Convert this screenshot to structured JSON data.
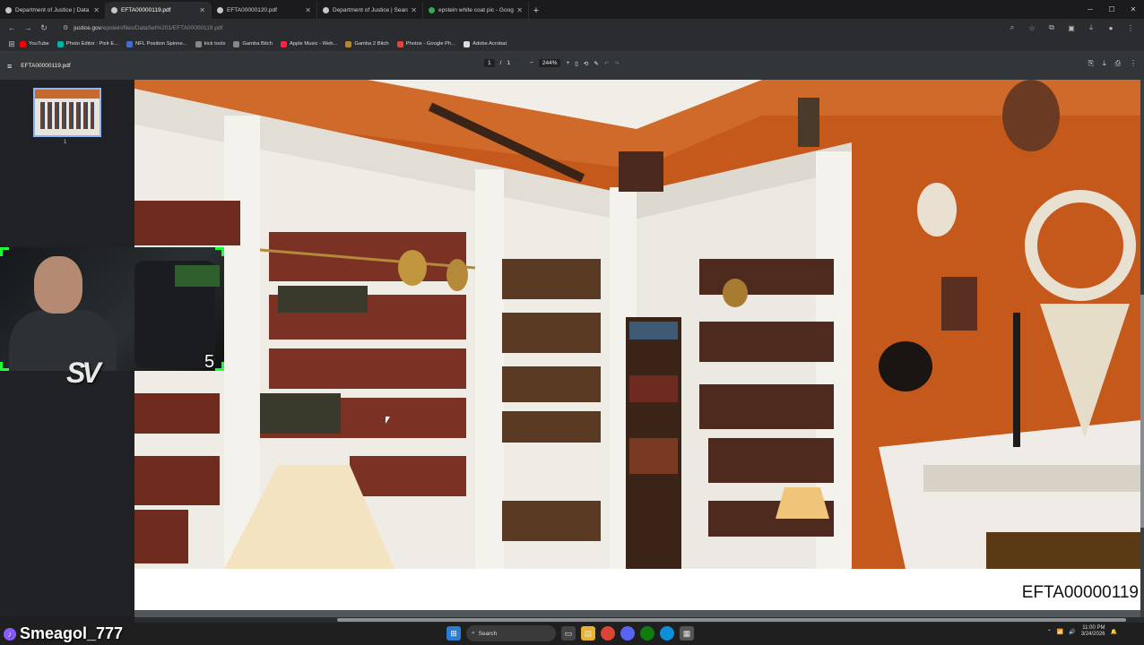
{
  "tabs": [
    {
      "title": "Department of Justice | Data Se",
      "color": "#c7c7c7",
      "active": false
    },
    {
      "title": "EFTA00000119.pdf",
      "color": "#c7c7c7",
      "active": true
    },
    {
      "title": "EFTA00000120.pdf",
      "color": "#c7c7c7",
      "active": false
    },
    {
      "title": "Department of Justice | Search",
      "color": "#c7c7c7",
      "active": false
    },
    {
      "title": "epstein white coat pic - Googl",
      "color": "#34a853",
      "active": false
    }
  ],
  "address": {
    "host": "justice.gov",
    "path": "/epstein/files/DataSet%201/EFTA00000119.pdf"
  },
  "bookmarks": [
    {
      "label": "YouTube",
      "color": "#ff0000"
    },
    {
      "label": "Photo Editor : Pixlr E...",
      "color": "#00b3a4"
    },
    {
      "label": "NFL Position Spinne...",
      "color": "#3b6fd6"
    },
    {
      "label": "kick tools",
      "color": "#888888"
    },
    {
      "label": "Gamba Bitch",
      "color": "#888888"
    },
    {
      "label": "Apple Music - Web...",
      "color": "#fa243c"
    },
    {
      "label": "Gamba 2 Bitch",
      "color": "#b8862b"
    },
    {
      "label": "Photos - Google Ph...",
      "color": "#ea4335"
    },
    {
      "label": "Adobe Acrobat",
      "color": "#dddddd"
    }
  ],
  "pdf": {
    "filename": "EFTA00000119.pdf",
    "page_current": "1",
    "page_total": "1",
    "zoom": "244%",
    "thumb_label": "1",
    "footer_id": "EFTA00000119"
  },
  "overlay": {
    "streamer": "Smeagol_777",
    "counter": "5",
    "logo": "SV"
  },
  "taskbar": {
    "search": "Search",
    "time": "11:00 PM",
    "date": "3/24/2026"
  }
}
